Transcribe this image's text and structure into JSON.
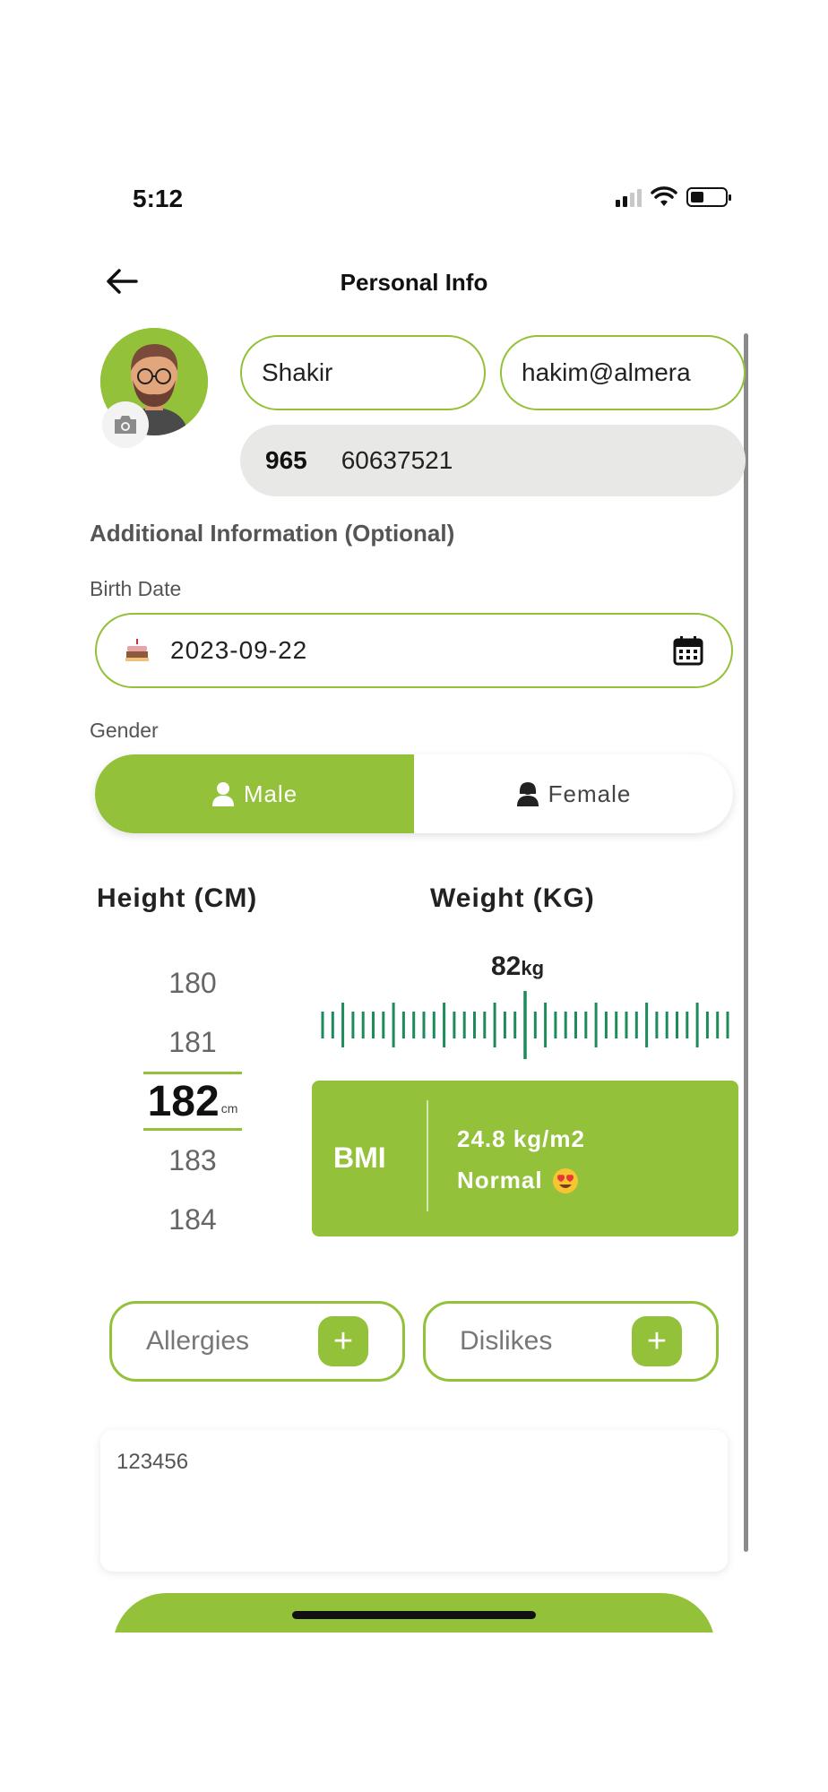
{
  "status_bar": {
    "time": "5:12"
  },
  "header": {
    "title": "Personal Info"
  },
  "profile": {
    "name_value": "Shakir",
    "email_value": "hakim@almera",
    "phone_code": "965",
    "phone_number": "60637521"
  },
  "additional": {
    "title": "Additional Information (Optional)",
    "birth_label": "Birth Date",
    "birth_value": "2023-09-22",
    "gender_label": "Gender",
    "gender_options": [
      "Male",
      "Female"
    ],
    "gender_selected": "Male"
  },
  "measurements": {
    "height_title": "Height (CM)",
    "weight_title": "Weight (KG)",
    "height_values": [
      "180",
      "181",
      "182",
      "183",
      "184"
    ],
    "height_selected": "182",
    "height_unit": "cm",
    "weight_value": "82",
    "weight_unit": "kg"
  },
  "bmi": {
    "label": "BMI",
    "value": "24.8 kg/m2",
    "status": "Normal"
  },
  "tags": {
    "allergies_label": "Allergies",
    "dislikes_label": "Dislikes",
    "plus_symbol": "+"
  },
  "notes": {
    "value": "123456"
  },
  "colors": {
    "accent": "#94c13a",
    "ruler": "#1f8a5a"
  }
}
